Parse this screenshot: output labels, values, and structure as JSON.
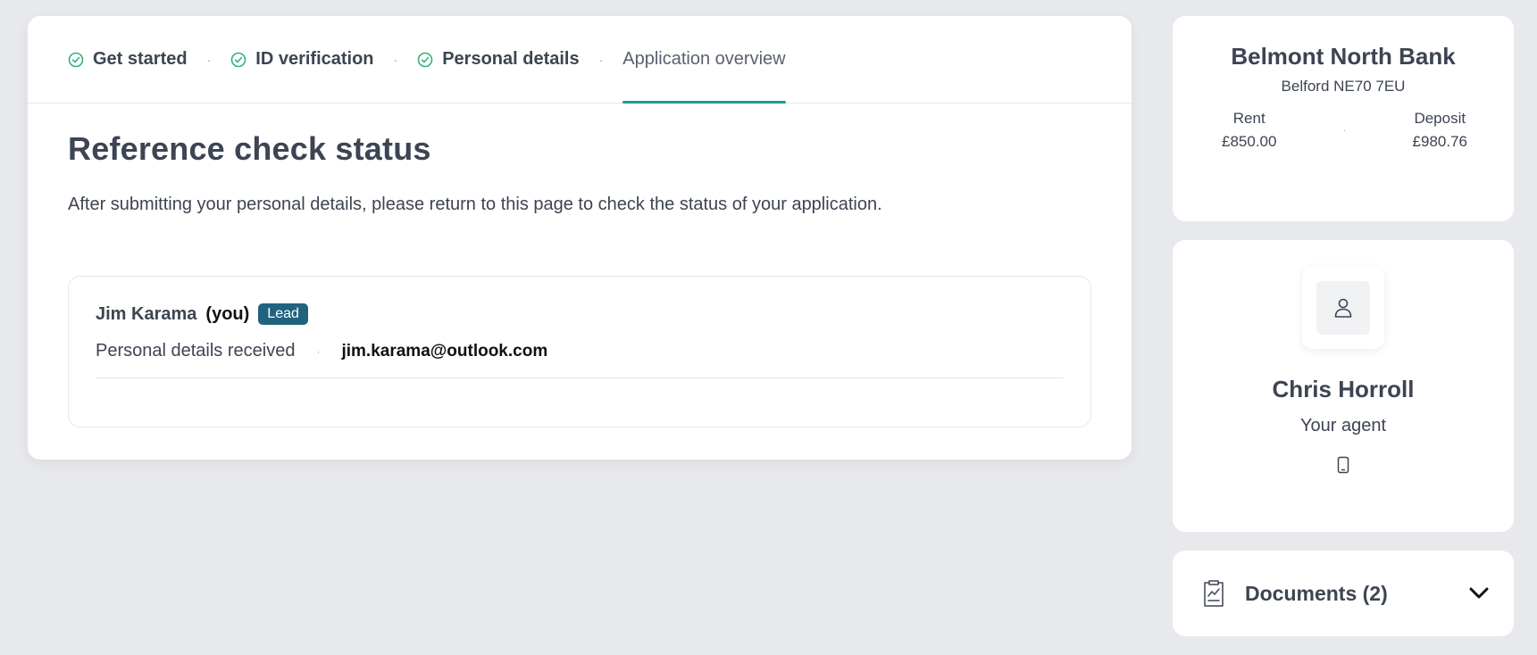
{
  "stepper": {
    "steps": [
      {
        "label": "Get started",
        "done": true
      },
      {
        "label": "ID verification",
        "done": true
      },
      {
        "label": "Personal details",
        "done": true
      },
      {
        "label": "Application overview",
        "done": false,
        "active": true
      }
    ]
  },
  "main": {
    "title": "Reference check status",
    "intro": "After submitting your personal details, please return to this page to check the status of your application.",
    "applicant": {
      "name": "Jim Karama",
      "you_tag": "(you)",
      "badge": "Lead",
      "status": "Personal details received",
      "email": "jim.karama@outlook.com"
    }
  },
  "property": {
    "title": "Belmont North Bank",
    "address": "Belford NE70 7EU",
    "rent_label": "Rent",
    "rent_value": "£850.00",
    "deposit_label": "Deposit",
    "deposit_value": "£980.76"
  },
  "agent": {
    "name": "Chris Horroll",
    "role": "Your agent",
    "avatar_icon": "person-icon",
    "contact_icon": "phone-icon"
  },
  "documents": {
    "label": "Documents (2)",
    "icon": "document-chart-icon",
    "toggle_icon": "chevron-down-icon"
  },
  "colors": {
    "accent": "#1a9a94",
    "badge": "#21627f",
    "check": "#2fb37c",
    "background": "#e8e9ed"
  }
}
